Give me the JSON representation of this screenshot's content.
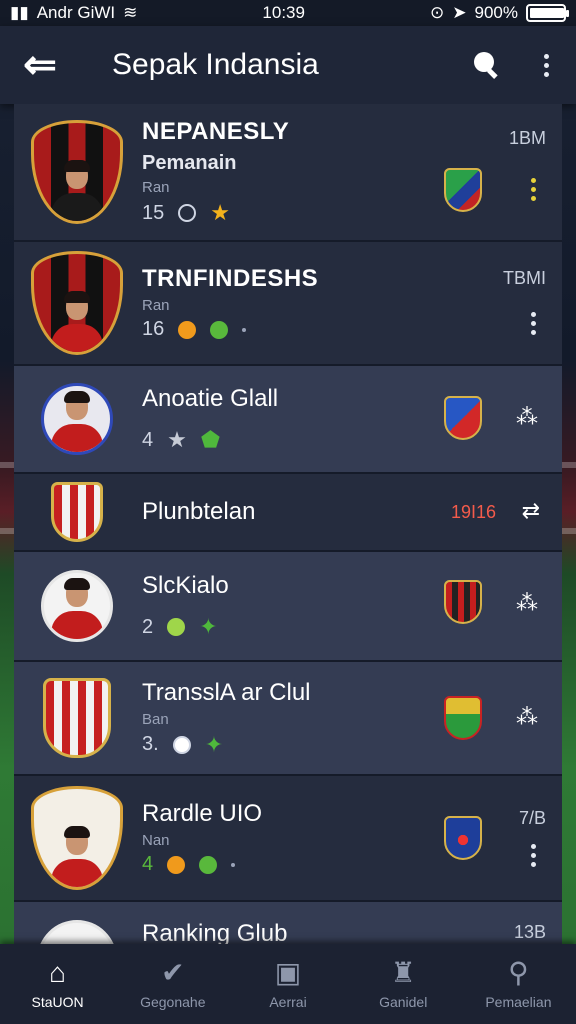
{
  "status_bar": {
    "carrier": "Andr GiWI",
    "time": "10:39",
    "battery": "900%"
  },
  "app_bar": {
    "title": "Sepak Indansia"
  },
  "rows": [
    {
      "name": "NEPANESLY",
      "subtitle": "Pemanain",
      "meta": "Ran",
      "stat": "15",
      "count": "1BM"
    },
    {
      "name": "TRNFINDESHS",
      "meta": "Ran",
      "stat": "16",
      "count": "TBMI"
    },
    {
      "name": "Anoatie Glall",
      "stat": "4"
    },
    {
      "name": "Plunbtelan",
      "count": "19I16"
    },
    {
      "name": "SlcKialo",
      "stat": "2"
    },
    {
      "name": "TransslA ar Clul",
      "meta": "Ban",
      "stat": "3."
    },
    {
      "name": "Rardle UIO",
      "meta": "Nan",
      "stat": "4",
      "count": "7/B"
    },
    {
      "name": "Ranking Glub",
      "count": "13B"
    }
  ],
  "bottom_nav": [
    {
      "label": "StaUON",
      "icon": "home-icon"
    },
    {
      "label": "Gegonahe",
      "icon": "check-shield-icon"
    },
    {
      "label": "Aerrai",
      "icon": "calendar-icon"
    },
    {
      "label": "Ganidel",
      "icon": "trophy-icon"
    },
    {
      "label": "Pemaelian",
      "icon": "search-person-icon"
    }
  ],
  "colors": {
    "app_bar": "#1f2638",
    "row_dark": "#252c3e",
    "row_light": "#343c53",
    "accent_orange": "#f09a1c",
    "accent_green": "#59b83c",
    "accent_red": "#f35b4b"
  }
}
